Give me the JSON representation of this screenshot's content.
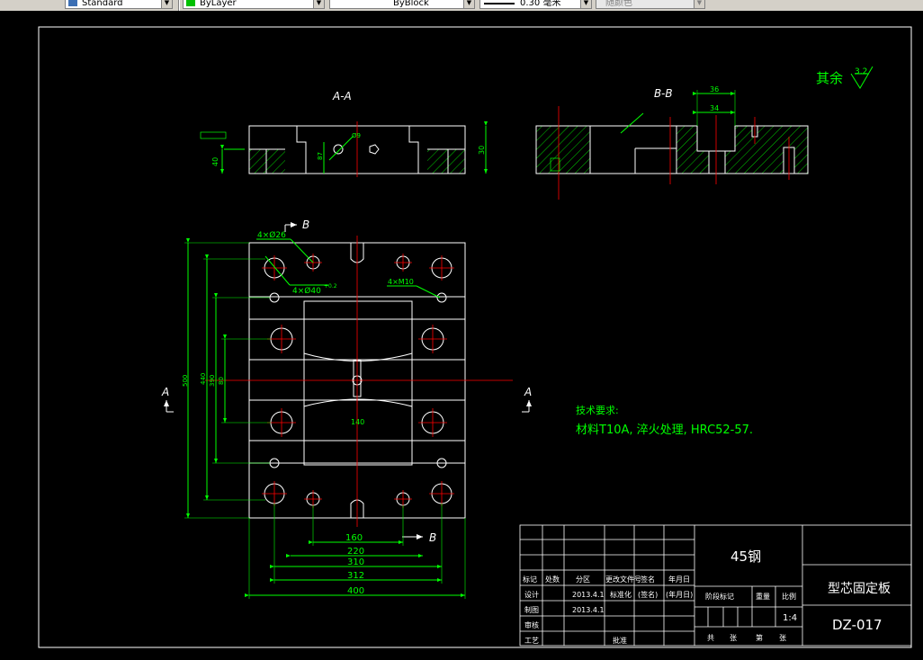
{
  "toolbar": {
    "text_style": "Standard",
    "layer": "ByLayer",
    "linetype": "ByBlock",
    "lineweight": "0.30 毫米",
    "plot_style": "随颜色"
  },
  "drawing": {
    "section_aa": "A-A",
    "section_bb": "B-B",
    "roughness_note": "其余",
    "roughness_value": "3.2",
    "view_arrow_a": "A",
    "view_arrow_b": "B",
    "callouts": {
      "holes_26": "4×Ø26",
      "holes_40": "4×Ø40",
      "holes_40_tol": "+0.2",
      "holes_m10": "4×M10"
    },
    "dimensions": {
      "w160": "160",
      "w220": "220",
      "w310": "310",
      "w312": "312",
      "w400": "400",
      "h500": "500",
      "h440": "440",
      "h390": "390",
      "h80": "80",
      "c140": "140",
      "bb36": "36",
      "bb34": "34",
      "aa40": "40",
      "aa30": "30",
      "aa87": "87",
      "aa9": "Ø9"
    },
    "tech_req_title": "技术要求:",
    "tech_req_body": "材料T10A, 淬火处理, HRC52-57."
  },
  "title_block": {
    "material": "45钢",
    "part_name": "型芯固定板",
    "drawing_no": "DZ-017",
    "scale": "1:4",
    "h_mark": "标记",
    "h_count": "处数",
    "h_zone": "分区",
    "h_docno": "更改文件号",
    "h_sign": "签名",
    "h_date": "年月日",
    "r_design": "设计",
    "r_design_date": "2013.4.1",
    "r_std": "标准化",
    "r_sign": "(签名)",
    "r_ymd": "(年月日)",
    "r_stage": "阶段标记",
    "r_weight": "重量",
    "r_scale": "比例",
    "r_draw": "制图",
    "r_draw_date": "2013.4.1",
    "r_check": "审核",
    "r_process": "工艺",
    "r_approve": "批准",
    "footer_total": "共",
    "footer_sheets": "张",
    "footer_no": "第",
    "footer_sheet": "张"
  },
  "colors": {
    "background": "#000000",
    "outline": "#ffffff",
    "dimension": "#00ff00",
    "centerline": "#ff0000",
    "hatch": "#00ff00",
    "toolbar": "#d4d0c8"
  }
}
